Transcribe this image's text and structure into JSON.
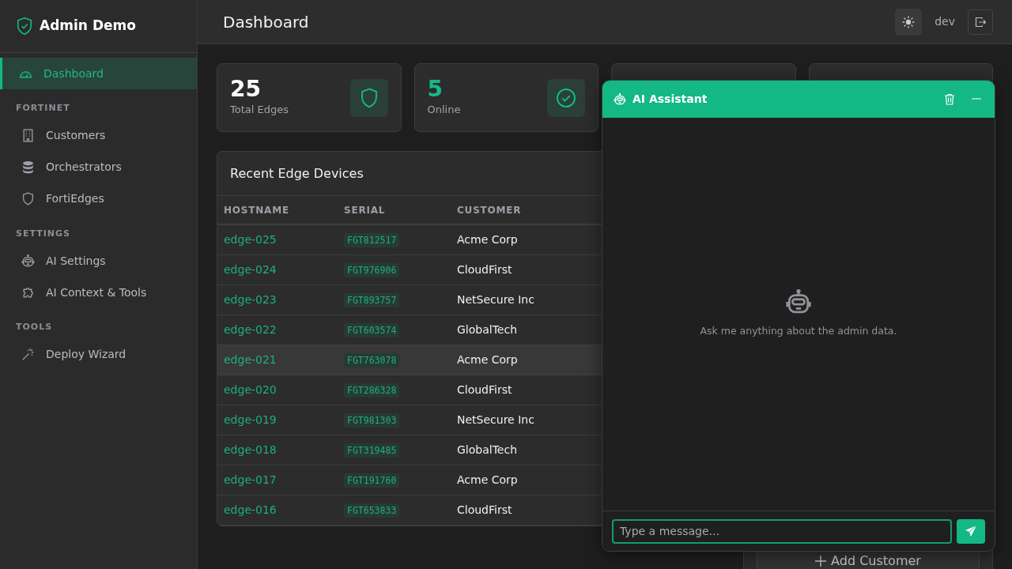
{
  "brand": {
    "title": "Admin Demo"
  },
  "sidebar": {
    "sections": [
      {
        "items": [
          {
            "label": "Dashboard",
            "selected": true
          }
        ]
      },
      {
        "heading": "FORTINET",
        "items": [
          {
            "label": "Customers",
            "selected": false
          },
          {
            "label": "Orchestrators",
            "selected": false
          },
          {
            "label": "FortiEdges",
            "selected": false
          }
        ]
      },
      {
        "heading": "SETTINGS",
        "items": [
          {
            "label": "AI Settings",
            "selected": false
          },
          {
            "label": "AI Context & Tools",
            "selected": false
          }
        ]
      },
      {
        "heading": "TOOLS",
        "items": [
          {
            "label": "Deploy Wizard",
            "selected": false
          }
        ]
      }
    ]
  },
  "header": {
    "title": "Dashboard",
    "user": "dev"
  },
  "stats": [
    {
      "value": "25",
      "label": "Total Edges",
      "accent": false
    },
    {
      "value": "5",
      "label": "Online",
      "accent": true
    }
  ],
  "table": {
    "title": "Recent Edge Devices",
    "columns": [
      "HOSTNAME",
      "SERIAL",
      "CUSTOMER"
    ],
    "rows": [
      {
        "hostname": "edge-025",
        "serial": "FGT812517",
        "customer": "Acme Corp",
        "selected": false
      },
      {
        "hostname": "edge-024",
        "serial": "FGT976906",
        "customer": "CloudFirst",
        "selected": false
      },
      {
        "hostname": "edge-023",
        "serial": "FGT893757",
        "customer": "NetSecure Inc",
        "selected": false
      },
      {
        "hostname": "edge-022",
        "serial": "FGT603574",
        "customer": "GlobalTech",
        "selected": false
      },
      {
        "hostname": "edge-021",
        "serial": "FGT763078",
        "customer": "Acme Corp",
        "selected": true
      },
      {
        "hostname": "edge-020",
        "serial": "FGT286328",
        "customer": "CloudFirst",
        "selected": false
      },
      {
        "hostname": "edge-019",
        "serial": "FGT981303",
        "customer": "NetSecure Inc",
        "selected": false
      },
      {
        "hostname": "edge-018",
        "serial": "FGT319485",
        "customer": "GlobalTech",
        "selected": false
      },
      {
        "hostname": "edge-017",
        "serial": "FGT191760",
        "customer": "Acme Corp",
        "selected": false
      },
      {
        "hostname": "edge-016",
        "serial": "FGT653833",
        "customer": "CloudFirst",
        "selected": false
      }
    ]
  },
  "side_card": {
    "button": "Add Customer"
  },
  "assistant": {
    "title": "AI Assistant",
    "empty_text": "Ask me anything about the admin data.",
    "placeholder": "Type a message..."
  }
}
